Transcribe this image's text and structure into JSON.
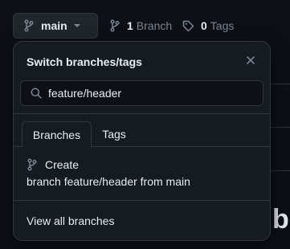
{
  "header": {
    "branch_name": "main",
    "branch_count": "1",
    "branch_label": "Branch",
    "tag_count": "0",
    "tag_label": "Tags"
  },
  "dropdown": {
    "title": "Switch branches/tags",
    "search_value": "feature/header",
    "tabs": [
      {
        "label": "Branches",
        "active": true
      },
      {
        "label": "Tags",
        "active": false
      }
    ],
    "create_label": "Create",
    "create_detail": "branch feature/header from main",
    "view_all_label": "View all branches"
  },
  "background": {
    "partial_heading": "b"
  },
  "colors": {
    "page_bg": "#0d1117",
    "panel_bg": "#161b22",
    "border": "#30363d",
    "text": "#e6edf3",
    "muted": "#7d8590"
  },
  "icons": {
    "branch": "git-branch-icon",
    "tag": "tag-icon",
    "search": "search-icon",
    "close": "close-icon",
    "caret": "caret-down-icon"
  }
}
